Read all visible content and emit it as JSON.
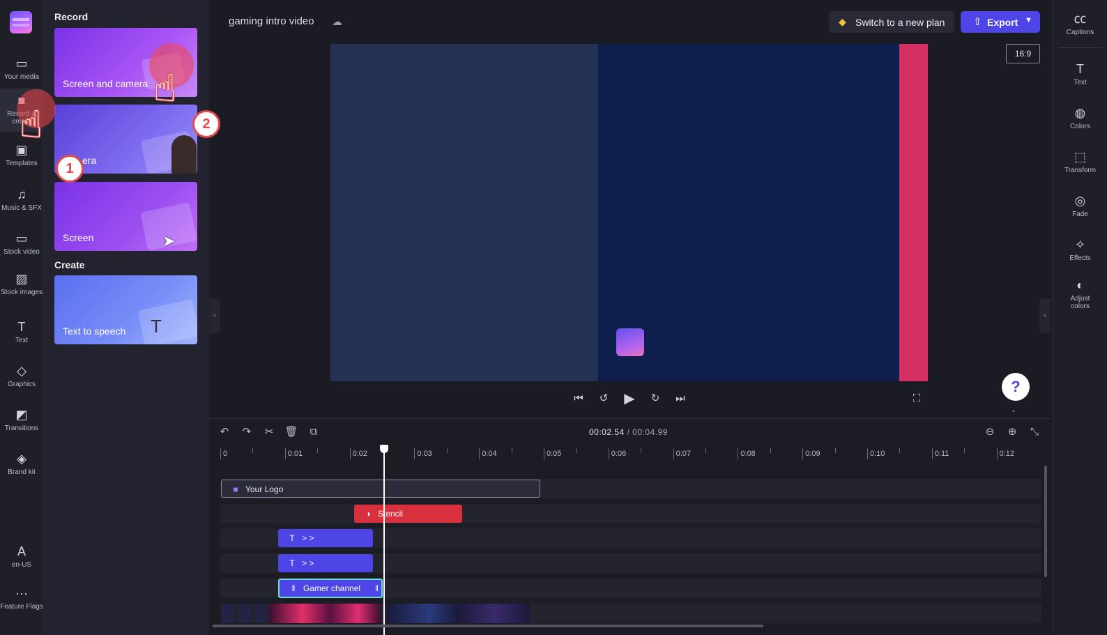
{
  "left_nav": {
    "items": [
      {
        "label": "Your media",
        "icon": "folder-icon"
      },
      {
        "label": "Record & create",
        "icon": "camera-icon"
      },
      {
        "label": "Templates",
        "icon": "template-icon"
      },
      {
        "label": "Music & SFX",
        "icon": "music-icon"
      },
      {
        "label": "Stock video",
        "icon": "film-icon"
      },
      {
        "label": "Stock images",
        "icon": "image-icon"
      },
      {
        "label": "Text",
        "icon": "text-icon"
      },
      {
        "label": "Graphics",
        "icon": "shapes-icon"
      },
      {
        "label": "Transitions",
        "icon": "transition-icon"
      },
      {
        "label": "Brand kit",
        "icon": "brand-icon"
      }
    ],
    "bottom": [
      {
        "label": "en-US",
        "icon": "language-icon"
      },
      {
        "label": "Feature Flags",
        "icon": "more-icon"
      }
    ]
  },
  "panel": {
    "record_heading": "Record",
    "cards": [
      {
        "label": "Screen and camera"
      },
      {
        "label": "era"
      },
      {
        "label": "Screen"
      }
    ],
    "create_heading": "Create",
    "create_cards": [
      {
        "label": "Text to speech"
      }
    ]
  },
  "header": {
    "project_title": "gaming intro video",
    "plan_button": "Switch to a new plan",
    "export_button": "Export",
    "aspect_ratio": "16:9"
  },
  "playback": {
    "help": "?"
  },
  "right_nav": {
    "items": [
      {
        "label": "Captions",
        "icon": "captions-icon"
      },
      {
        "label": "Text",
        "icon": "text-icon"
      },
      {
        "label": "Colors",
        "icon": "palette-icon"
      },
      {
        "label": "Transform",
        "icon": "transform-icon"
      },
      {
        "label": "Fade",
        "icon": "fade-icon"
      },
      {
        "label": "Effects",
        "icon": "effects-icon"
      },
      {
        "label": "Adjust colors",
        "icon": "adjust-icon"
      }
    ]
  },
  "timeline": {
    "current_time": "00:02.54",
    "total_time": "/ 00:04.99",
    "ruler": [
      "0",
      "0:01",
      "0:02",
      "0:03",
      "0:04",
      "0:05",
      "0:06",
      "0:07",
      "0:08",
      "0:09",
      "0:10",
      "0:11",
      "0:12"
    ],
    "clips": {
      "logo": "Your Logo",
      "stencil": "Stencil",
      "text1": "> >",
      "text2": "> >",
      "gamer": "Gamer channel"
    }
  },
  "overlays": {
    "badge1": "1",
    "badge2": "2"
  },
  "colors": {
    "accent": "#4d45e6",
    "stencil": "#d8303c",
    "preview_bg": "#0e1f4d",
    "preview_left": "#253256",
    "preview_right": "#d52f63"
  }
}
